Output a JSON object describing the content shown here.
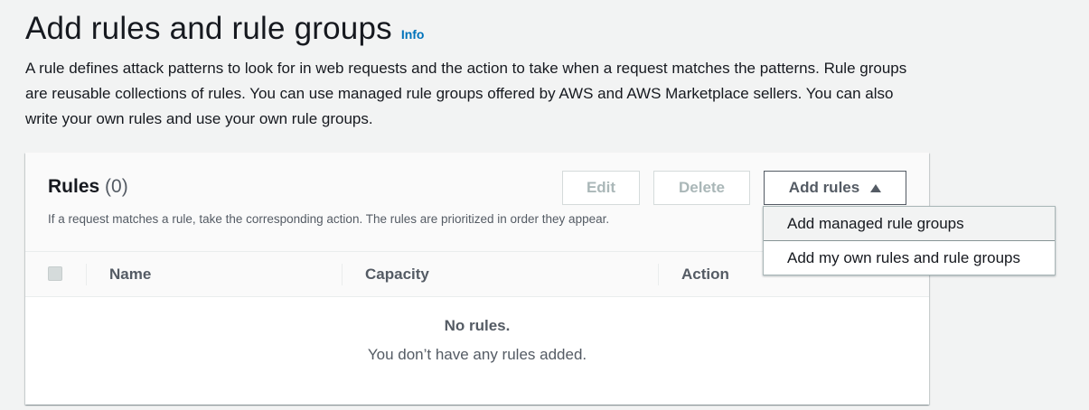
{
  "section": {
    "title": "Add rules and rule groups",
    "info_label": "Info",
    "description": "A rule defines attack patterns to look for in web requests and the action to take when a request matches the patterns. Rule groups are reusable collections of rules. You can use managed rule groups offered by AWS and AWS Marketplace sellers. You can also write your own rules and use your own rule groups."
  },
  "rules_panel": {
    "heading": "Rules",
    "count": "(0)",
    "description": "If a request matches a rule, take the corresponding action. The rules are prioritized in order they appear.",
    "buttons": {
      "edit": "Edit",
      "delete": "Delete",
      "add_rules": "Add rules"
    },
    "columns": [
      "Name",
      "Capacity",
      "Action"
    ],
    "empty": {
      "title": "No rules.",
      "description": "You don’t have any rules added."
    }
  },
  "add_rules_menu": {
    "items": [
      "Add managed rule groups",
      "Add my own rules and rule groups"
    ],
    "highlighted_index": 0
  },
  "colors": {
    "background": "#f2f3f3",
    "link": "#0073bb",
    "text": "#16191f",
    "secondary_text": "#545b64",
    "disabled": "#aab7b8"
  },
  "icons": {
    "add_rules_caret": "caret-up-icon",
    "select_all": "checkbox-icon"
  }
}
